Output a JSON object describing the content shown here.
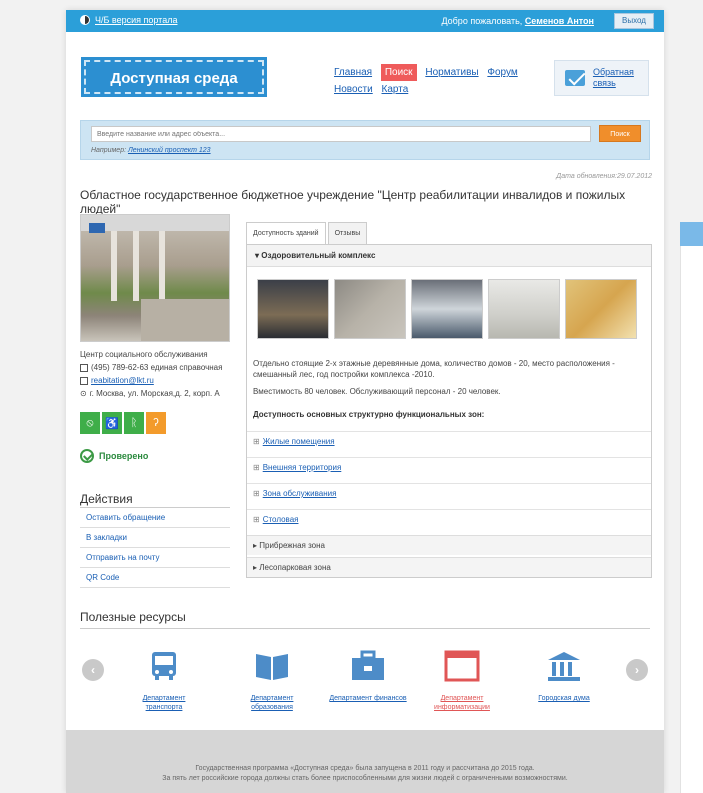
{
  "topbar": {
    "bw_version": "Ч/Б версия портала",
    "welcome": "Добро пожаловать,",
    "user": "Семенов Антон",
    "logout": "Выход"
  },
  "logo": "Доступная среда",
  "nav": [
    "Главная",
    "Поиск",
    "Нормативы",
    "Форум",
    "Новости",
    "Карта"
  ],
  "feedback": "Обратная связь",
  "search": {
    "placeholder": "Введите название или адрес объекта...",
    "button": "Поиск",
    "example_prefix": "Например:",
    "example_value": "Ленинский проспект 123"
  },
  "updated": "Дата обновления:29.07.2012",
  "org_title": "Областное государственное бюджетное учреждение \"Центр реабилитации инвалидов и пожилых людей\"",
  "contact": {
    "type": "Центр социального обслуживания",
    "phone": "(495) 789-62-63 единая справочная",
    "email": "reabitation@lkt.ru",
    "address": "г. Москва, ул. Морская,д. 2, корп. А"
  },
  "badges": [
    {
      "icon": "hearing-icon",
      "color": "#3fae49",
      "glyph": "⦸"
    },
    {
      "icon": "wheelchair-icon",
      "color": "#3fae49",
      "glyph": "♿"
    },
    {
      "icon": "person-icon",
      "color": "#3fae49",
      "glyph": "🚶"
    },
    {
      "icon": "ear-icon",
      "color": "#f39b2b",
      "glyph": "ʔ"
    }
  ],
  "verified": "Проверено",
  "actions": {
    "title": "Действия",
    "items": [
      "Оставить обращение",
      "В закладки",
      "Отправить на почту",
      "QR Code"
    ]
  },
  "tabs": [
    "Доступность зданий",
    "Отзывы"
  ],
  "panel": {
    "section": "Оздоровительный комплекс",
    "description": "Отдельно стоящие 2-х этажные деревянные дома, количество домов - 20, место расположения - смешанный лес, год постройки комплекса -2010.",
    "capacity": "Вместимость 80 человек. Обслуживающий персонал - 20 человек.",
    "zones_title": "Доступность основных структурно функциональных зон:",
    "zones": [
      "Жилые помещения",
      "Внешняя территория",
      "Зона обслуживания",
      "Столовая"
    ],
    "subzones": [
      "Прибрежная зона",
      "Лесопарковая зона"
    ]
  },
  "resources": {
    "title": "Полезные ресурсы",
    "items": [
      {
        "label": "Департамент транспорта",
        "icon": "bus-icon"
      },
      {
        "label": "Департамент образования",
        "icon": "book-icon"
      },
      {
        "label": "Департамент финансов",
        "icon": "briefcase-icon"
      },
      {
        "label": "Департамент информатизации",
        "icon": "window-icon"
      },
      {
        "label": "Городская дума",
        "icon": "building-icon"
      }
    ]
  },
  "footer": {
    "line1": "Государственная программа «Доступная среда» была запущена в 2011 году и рассчитана до 2015 года.",
    "line2": "За пять лет российские города должны стать более приспособленными для жизни людей с ограниченными возможностями."
  },
  "colors": {
    "accent": "#2b9fd9",
    "search_active": "#ef5b5b",
    "button_orange": "#f08e2b",
    "hot_link": "#e05656"
  }
}
